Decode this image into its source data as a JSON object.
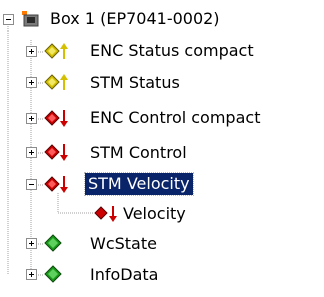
{
  "tree": {
    "root": {
      "label": "Box 1 (EP7041-0002)",
      "expanded": true
    },
    "items": [
      {
        "label": "ENC Status compact",
        "kind": "input",
        "expanded": false
      },
      {
        "label": "STM Status",
        "kind": "input",
        "expanded": false
      },
      {
        "label": "ENC Control compact",
        "kind": "output",
        "expanded": false
      },
      {
        "label": "STM Control",
        "kind": "output",
        "expanded": false
      },
      {
        "label": "STM Velocity",
        "kind": "output",
        "expanded": true,
        "selected": true,
        "children": [
          {
            "label": "Velocity",
            "kind": "output-variable"
          }
        ]
      },
      {
        "label": "WcState",
        "kind": "status",
        "expanded": false
      },
      {
        "label": "InfoData",
        "kind": "status",
        "expanded": false
      }
    ]
  },
  "colors": {
    "selection_bg": "#0a246a",
    "selection_text": "#ffffff",
    "input_icon": "#d4c000",
    "output_icon": "#cc0000",
    "status_icon": "#1a9a1a",
    "tree_line": "#a0a0a0"
  },
  "icons": {
    "expander_collapsed": "plus-box",
    "expander_expanded": "minus-box",
    "root": "ethercat-box-icon",
    "input": "input-arrow-up-icon",
    "output": "output-arrow-down-icon",
    "status": "green-diamond-icon"
  }
}
